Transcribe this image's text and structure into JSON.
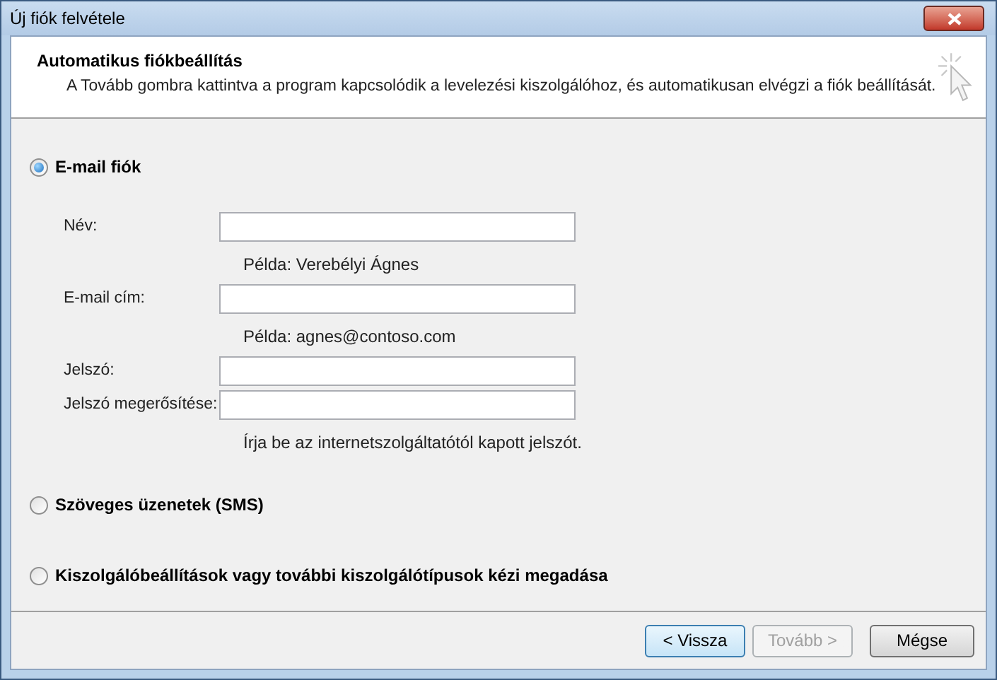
{
  "window": {
    "title": "Új fiók felvétele"
  },
  "header": {
    "title": "Automatikus fiókbeállítás",
    "description": "A Tovább gombra kattintva a program kapcsolódik a levelezési kiszolgálóhoz, és automatikusan elvégzi a fiók beállítását."
  },
  "options": [
    {
      "label": "E-mail fiók",
      "selected": true,
      "fields": [
        {
          "label": "Név:",
          "hint": "Példa: Verebélyi Ágnes"
        },
        {
          "label": "E-mail cím:",
          "hint": "Példa: agnes@contoso.com"
        },
        {
          "label": "Jelszó:"
        },
        {
          "label": "Jelszó megerősítése:",
          "hint": "Írja be az internetszolgáltatótól kapott jelszót."
        }
      ]
    },
    {
      "label": "Szöveges üzenetek (SMS)",
      "selected": false
    },
    {
      "label": "Kiszolgálóbeállítások vagy további kiszolgálótípusok kézi megadása",
      "selected": false
    }
  ],
  "buttons": [
    {
      "label": "< Vissza",
      "disabled": false,
      "default": true
    },
    {
      "label": "Tovább >",
      "disabled": true,
      "default": false
    },
    {
      "label": "Mégse",
      "disabled": false,
      "default": false
    }
  ]
}
